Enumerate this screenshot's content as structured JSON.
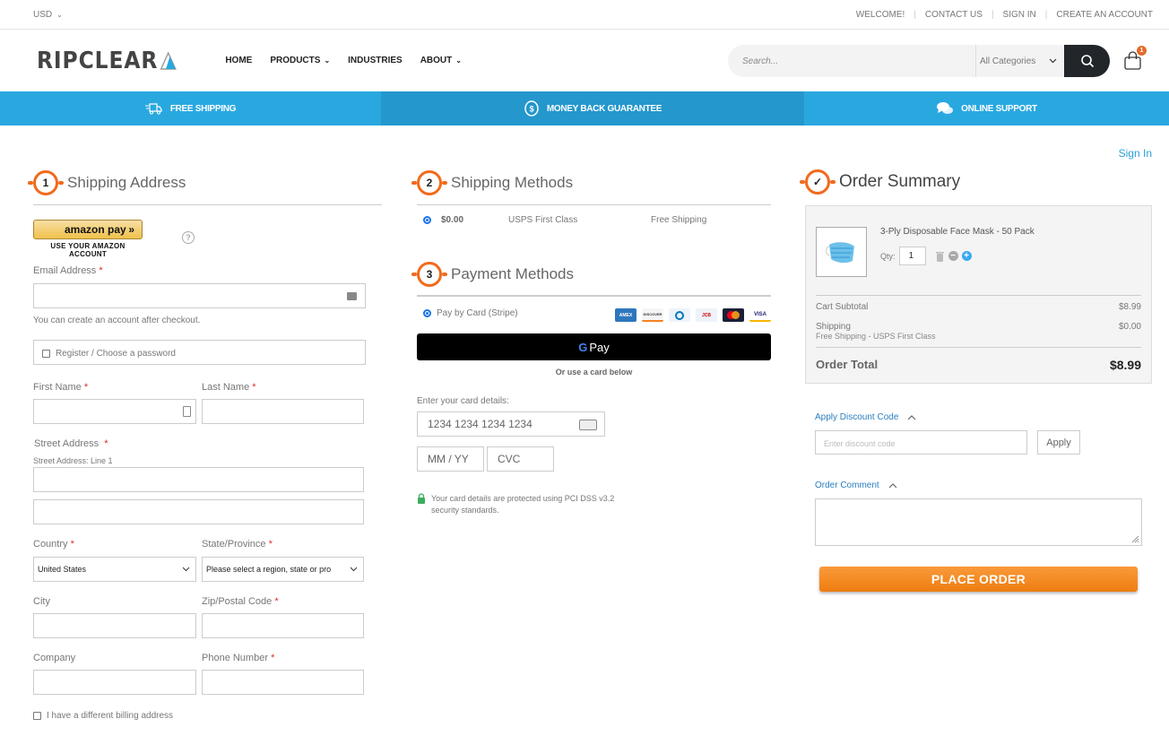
{
  "topbar": {
    "currency": "USD",
    "links": [
      "WELCOME!",
      "CONTACT US",
      "SIGN IN",
      "CREATE AN ACCOUNT"
    ]
  },
  "header": {
    "logo": "RIPCLEAR",
    "nav": [
      {
        "label": "HOME",
        "dropdown": false
      },
      {
        "label": "PRODUCTS",
        "dropdown": true
      },
      {
        "label": "INDUSTRIES",
        "dropdown": false
      },
      {
        "label": "ABOUT",
        "dropdown": true
      }
    ],
    "search_placeholder": "Search...",
    "category": "All Categories",
    "cart_count": "1"
  },
  "banner": {
    "items": [
      {
        "icon": "truck-icon",
        "label": "FREE SHIPPING"
      },
      {
        "icon": "dollar-coin-icon",
        "label": "MONEY BACK GUARANTEE"
      },
      {
        "icon": "chat-bubbles-icon",
        "label": "ONLINE SUPPORT"
      }
    ]
  },
  "signin_link": "Sign In",
  "shipping_address": {
    "step": "1",
    "title": "Shipping Address",
    "amazon_pay": {
      "label": "amazon pay",
      "arrows": "»",
      "sub": "USE YOUR AMAZON ACCOUNT",
      "help": "?"
    },
    "email_label": "Email Address",
    "email_note": "You can create an account after checkout.",
    "register_label": "Register / Choose a password",
    "first_name_label": "First Name",
    "last_name_label": "Last Name",
    "street_label": "Street Address",
    "street_line1_label": "Street Address: Line 1",
    "country_label": "Country",
    "country_value": "United States",
    "state_label": "State/Province",
    "state_value": "Please select a region, state or pro",
    "city_label": "City",
    "zip_label": "Zip/Postal Code",
    "company_label": "Company",
    "phone_label": "Phone Number",
    "billing_label": "I have a different billing address",
    "required": "*"
  },
  "shipping_methods": {
    "step": "2",
    "title": "Shipping Methods",
    "options": [
      {
        "price": "$0.00",
        "carrier": "USPS First Class",
        "name": "Free Shipping",
        "selected": true
      }
    ]
  },
  "payment_methods": {
    "step": "3",
    "title": "Payment Methods",
    "option_label": "Pay by Card (Stripe)",
    "cards": [
      "AMEX",
      "DISCOVER",
      "DINERS",
      "JCB",
      "MASTERCARD",
      "VISA"
    ],
    "gpay_label": "Pay",
    "or_card": "Or use a card below",
    "card_details_label": "Enter your card details:",
    "card_number_placeholder": "1234 1234 1234 1234",
    "expiry_placeholder": "MM / YY",
    "cvc_placeholder": "CVC",
    "secure_note_1": "Your card details are protected using PCI DSS v3.2",
    "secure_note_2": "security standards."
  },
  "order_summary": {
    "step": "✓",
    "title": "Order Summary",
    "item": {
      "name": "3-Ply Disposable Face Mask - 50 Pack",
      "qty_label": "Qty:",
      "qty": "1"
    },
    "subtotal_label": "Cart Subtotal",
    "subtotal": "$8.99",
    "shipping_label": "Shipping",
    "shipping_method": "Free Shipping - USPS First Class",
    "shipping": "$0.00",
    "total_label": "Order Total",
    "total": "$8.99",
    "discount_label": "Apply Discount Code",
    "discount_placeholder": "Enter discount code",
    "apply_label": "Apply",
    "comment_label": "Order Comment",
    "place_order": "PLACE ORDER"
  },
  "colors": {
    "accent": "#f26a1b",
    "banner": "#29a8e0",
    "banner_mid": "#2497cc",
    "link": "#2a9fd6",
    "button": "#ee7d10"
  }
}
